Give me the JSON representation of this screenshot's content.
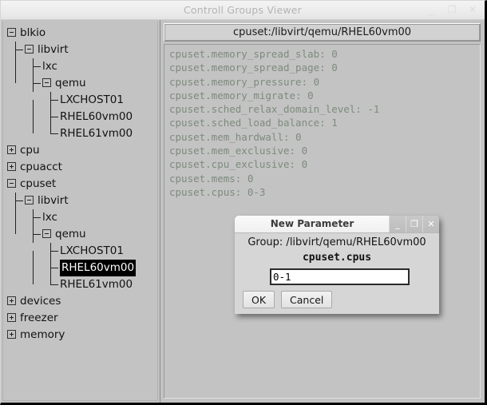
{
  "window": {
    "title": "Controll Groups Viewer",
    "controls": [
      {
        "name": "minimize",
        "glyph": "_"
      },
      {
        "name": "maximize",
        "glyph": "❐"
      },
      {
        "name": "close",
        "glyph": "✕"
      }
    ]
  },
  "path_header": {
    "text": "cpuset:/libvirt/qemu/RHEL60vm00"
  },
  "parameters": [
    {
      "name": "cpuset.memory_spread_slab:",
      "value": "0"
    },
    {
      "name": "cpuset.memory_spread_page:",
      "value": "0"
    },
    {
      "name": "cpuset.memory_pressure:",
      "value": "0"
    },
    {
      "name": "cpuset.memory_migrate:",
      "value": "0"
    },
    {
      "name": "cpuset.sched_relax_domain_level:",
      "value": "-1"
    },
    {
      "name": "cpuset.sched_load_balance:",
      "value": "1"
    },
    {
      "name": "cpuset.mem_hardwall:",
      "value": "0"
    },
    {
      "name": "cpuset.mem_exclusive:",
      "value": "0"
    },
    {
      "name": "cpuset.cpu_exclusive:",
      "value": "0"
    },
    {
      "name": "cpuset.mems:",
      "value": "0"
    },
    {
      "name": "cpuset.cpus:",
      "value": "0-3"
    }
  ],
  "tree": [
    {
      "label": "blkio",
      "depth": 0,
      "expander": "minus",
      "selected": false
    },
    {
      "label": "libvirt",
      "depth": 1,
      "expander": "minus",
      "selected": false
    },
    {
      "label": "lxc",
      "depth": 2,
      "expander": "none",
      "selected": false
    },
    {
      "label": "qemu",
      "depth": 2,
      "expander": "minus",
      "selected": false
    },
    {
      "label": "LXCHOST01",
      "depth": 3,
      "expander": "none",
      "selected": false
    },
    {
      "label": "RHEL60vm00",
      "depth": 3,
      "expander": "none",
      "selected": false
    },
    {
      "label": "RHEL61vm00",
      "depth": 3,
      "expander": "none",
      "selected": false,
      "last": true
    },
    {
      "label": "cpu",
      "depth": 0,
      "expander": "plus",
      "selected": false
    },
    {
      "label": "cpuacct",
      "depth": 0,
      "expander": "plus",
      "selected": false
    },
    {
      "label": "cpuset",
      "depth": 0,
      "expander": "minus",
      "selected": false
    },
    {
      "label": "libvirt",
      "depth": 1,
      "expander": "minus",
      "selected": false
    },
    {
      "label": "lxc",
      "depth": 2,
      "expander": "none",
      "selected": false
    },
    {
      "label": "qemu",
      "depth": 2,
      "expander": "minus",
      "selected": false
    },
    {
      "label": "LXCHOST01",
      "depth": 3,
      "expander": "none",
      "selected": false
    },
    {
      "label": "RHEL60vm00",
      "depth": 3,
      "expander": "none",
      "selected": true
    },
    {
      "label": "RHEL61vm00",
      "depth": 3,
      "expander": "none",
      "selected": false,
      "last": true
    },
    {
      "label": "devices",
      "depth": 0,
      "expander": "plus",
      "selected": false
    },
    {
      "label": "freezer",
      "depth": 0,
      "expander": "plus",
      "selected": false
    },
    {
      "label": "memory",
      "depth": 0,
      "expander": "plus",
      "selected": false
    }
  ],
  "dialog": {
    "title": "New Parameter",
    "controls": [
      {
        "name": "minimize",
        "glyph": "_"
      },
      {
        "name": "maximize",
        "glyph": "❐"
      },
      {
        "name": "close",
        "glyph": "✕"
      }
    ],
    "group_line": "Group: /libvirt/qemu/RHEL60vm00",
    "parameter_name": "cpuset.cpus",
    "input_value": "0-1",
    "input_placeholder": "",
    "ok_label": "OK",
    "cancel_label": "Cancel"
  },
  "colors": {
    "window_bg": "#c3c3c3",
    "param_text": "#7d8b7d",
    "selection_bg": "#000000",
    "selection_fg": "#ffffff",
    "dialog_bg": "#d6d6d6"
  }
}
